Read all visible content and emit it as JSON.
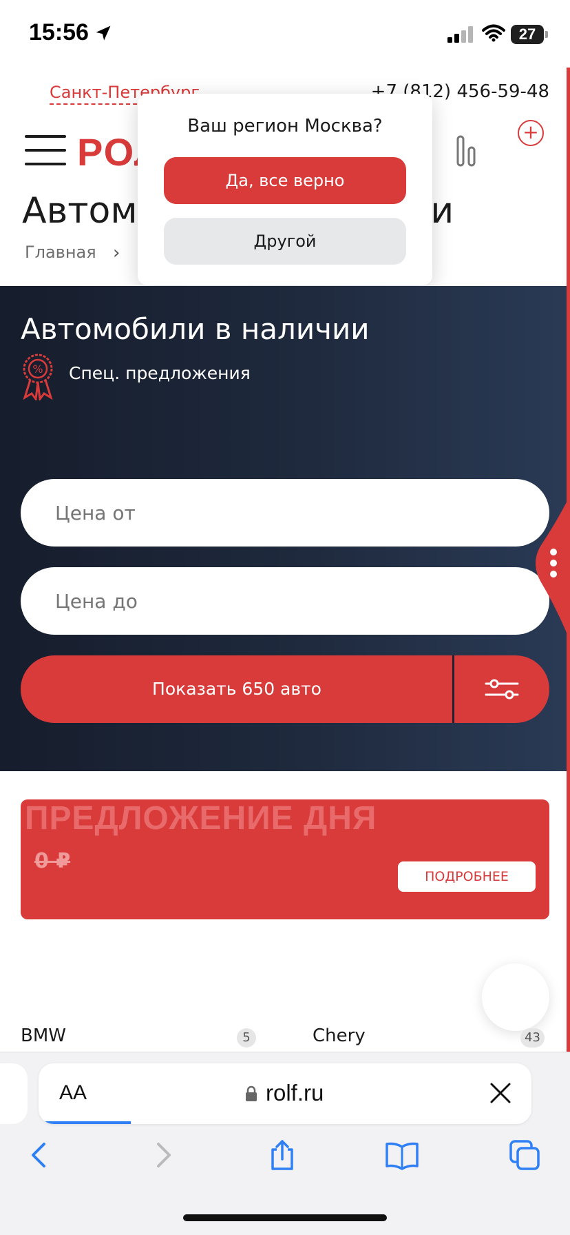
{
  "status_bar": {
    "time": "15:56",
    "battery": "27"
  },
  "header": {
    "city": "Санкт-Петербург",
    "phone": "+7 (812) 456-59-48",
    "logo": "РОЛЬФ",
    "page_title": "Автомобили в наличии",
    "breadcrumb": "Главная"
  },
  "region_popup": {
    "question": "Ваш регион Москва?",
    "confirm": "Да, все верно",
    "other": "Другой"
  },
  "hero": {
    "title": "Автомобили в наличии",
    "special_offers": "Спец. предложения",
    "price_from_placeholder": "Цена от",
    "price_to_placeholder": "Цена до",
    "show_button": "Показать 650 авто"
  },
  "deal": {
    "title": "ПРЕДЛОЖЕНИЕ ДНЯ",
    "price": "0 ₽",
    "more": "ПОДРОБНЕЕ"
  },
  "brands": [
    {
      "name": "BMW",
      "count": "5"
    },
    {
      "name": "Chery",
      "count": "43"
    }
  ],
  "safari": {
    "aa": "AA",
    "url": "rolf.ru"
  },
  "colors": {
    "accent": "#d93a3a",
    "hero_bg": "#1f2a3e"
  }
}
